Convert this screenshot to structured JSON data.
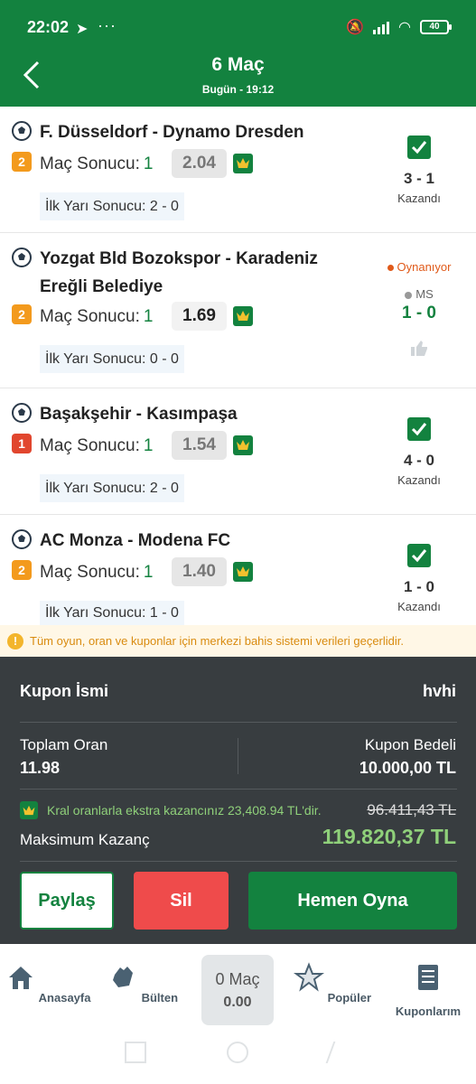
{
  "status_bar": {
    "time": "22:02",
    "telegram_icon": "telegram-icon",
    "dots": "···",
    "battery": "40"
  },
  "header": {
    "title": "6 Maç",
    "subtitle": "Bugün - 19:12"
  },
  "matches": [
    {
      "teams": "F. Düsseldorf - Dynamo Dresden",
      "badge": "2",
      "market": "Maç Sonucu:",
      "pick": "1",
      "odds": "2.04",
      "half": "İlk Yarı Sonucu: 2 - 0",
      "score": "3 - 1",
      "status": "Kazandı"
    },
    {
      "teams_line1": "Yozgat Bld Bozokspor - Karadeniz",
      "teams_line2": "Ereğli Belediye",
      "badge": "2",
      "market": "Maç Sonucu:",
      "pick": "1",
      "odds": "1.69",
      "half": "İlk Yarı Sonucu: 0 - 0",
      "live": "Oynanıyor",
      "period": "MS",
      "score": "1 - 0"
    },
    {
      "teams": "Başakşehir - Kasımpaşa",
      "badge": "1",
      "market": "Maç Sonucu:",
      "pick": "1",
      "odds": "1.54",
      "half": "İlk Yarı Sonucu: 2 - 0",
      "score": "4 - 0",
      "status": "Kazandı"
    },
    {
      "teams": "AC Monza - Modena FC",
      "badge": "2",
      "market": "Maç Sonucu:",
      "pick": "1",
      "odds": "1.40",
      "half": "İlk Yarı Sonucu: 1 - 0",
      "score": "1 - 0",
      "status": "Kazandı"
    }
  ],
  "notice": "Tüm oyun, oran ve kuponlar için merkezi bahis sistemi verileri geçerlidir.",
  "coupon": {
    "name_label": "Kupon İsmi",
    "name_value": "hvhi",
    "total_odds_label": "Toplam Oran",
    "total_odds": "11.98",
    "stake_label": "Kupon Bedeli",
    "stake": "10.000,00 TL",
    "king_text": "Kral oranlarla ekstra kazancınız 23,408.94 TL'dir.",
    "old_max": "96.411,43 TL",
    "max_label": "Maksimum Kazanç",
    "max_value": "119.820,37 TL",
    "share": "Paylaş",
    "delete": "Sil",
    "play": "Hemen Oyna"
  },
  "nav": {
    "home": "Anasayfa",
    "bulletin": "Bülten",
    "center_top": "0 Maç",
    "center_bottom": "0.00",
    "popular": "Popüler",
    "coupons": "Kuponlarım"
  },
  "colors": {
    "brand_green": "#13823f",
    "panel": "#383d40",
    "accent_green": "#8fd07a",
    "danger": "#ef4b4b"
  }
}
